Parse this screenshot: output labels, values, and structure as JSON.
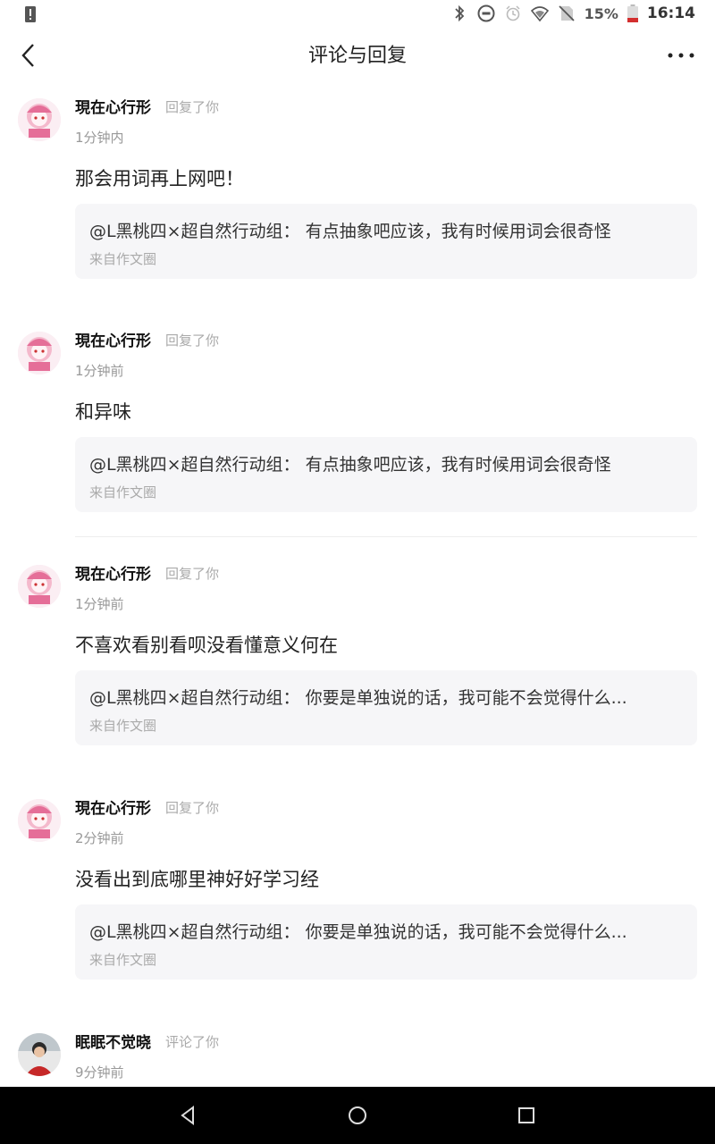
{
  "status_bar": {
    "battery_percent": "15%",
    "time": "16:14",
    "icons": [
      "notification-icon",
      "bluetooth-icon",
      "dnd-icon",
      "alarm-icon",
      "wifi-icon",
      "no-sim-icon",
      "battery-low-icon"
    ]
  },
  "header": {
    "title": "评论与回复",
    "back_icon": "back-chevron-icon",
    "more_icon": "more-dots-icon"
  },
  "items": [
    {
      "user": "現在心行形",
      "action": "回复了你",
      "time": "1分钟内",
      "content": "那会用词再上网吧！",
      "quote_author": "@L黑桃四×超自然行动组：",
      "quote_text": "有点抽象吧应该，我有时候用词会很奇怪",
      "quote_source": "来自作文圈"
    },
    {
      "user": "現在心行形",
      "action": "回复了你",
      "time": "1分钟前",
      "content": "和异味",
      "quote_author": "@L黑桃四×超自然行动组：",
      "quote_text": "有点抽象吧应该，我有时候用词会很奇怪",
      "quote_source": "来自作文圈"
    },
    {
      "user": "現在心行形",
      "action": "回复了你",
      "time": "1分钟前",
      "content": "不喜欢看别看呗没看懂意义何在",
      "quote_author": "@L黑桃四×超自然行动组：",
      "quote_text": "你要是单独说的话，我可能不会觉得什么...",
      "quote_source": "来自作文圈"
    },
    {
      "user": "現在心行形",
      "action": "回复了你",
      "time": "2分钟前",
      "content": "没看出到底哪里神好好学习经",
      "quote_author": "@L黑桃四×超自然行动组：",
      "quote_text": "你要是单独说的话，我可能不会觉得什么...",
      "quote_source": "来自作文圈"
    },
    {
      "user": "眠眠不觉晓",
      "action": "评论了你",
      "time": "9分钟前"
    }
  ],
  "nav_bar": {
    "icons": [
      "back-triangle-icon",
      "home-circle-icon",
      "recents-square-icon"
    ]
  }
}
